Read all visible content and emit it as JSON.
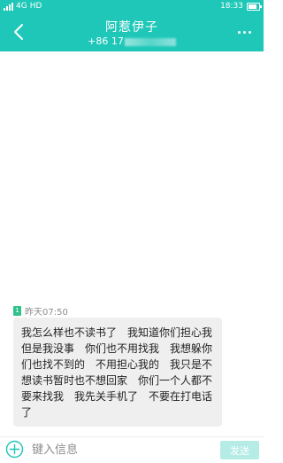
{
  "status_bar": {
    "network_type": "4G",
    "hd_label": "HD",
    "time": "18:33",
    "battery_level": 0.8
  },
  "header": {
    "contact_name": "阿惹伊子",
    "phone_prefix": "+86 17"
  },
  "conversation": {
    "sim_label": "1",
    "timestamp": "昨天07:50",
    "message": "我怎么样也不读书了　我知道你们担心我　但是我没事　你们也不用找我　我想躲你们也找不到的　不用担心我的　我只是不想读书暂时也不想回家　你们一个人都不要来找我　我先关手机了　不要在打电话了"
  },
  "composer": {
    "placeholder": "键入信息",
    "send_label": "发送"
  },
  "icons": {
    "back": "chevron-left-icon",
    "more": "more-dots-icon",
    "add": "plus-circle-icon",
    "sim": "sim-1-icon"
  },
  "colors": {
    "accent": "#1ec7b8",
    "bubble": "#efefef",
    "send_disabled": "#b5ece6",
    "sim_badge": "#2fc38b"
  }
}
